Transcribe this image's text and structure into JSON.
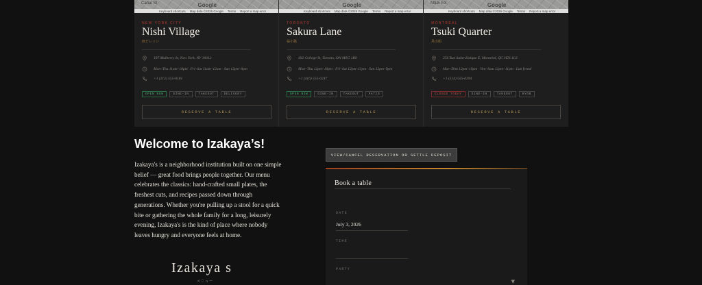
{
  "locations": [
    {
      "map": {
        "street": "Canal St",
        "google": "Google",
        "attribution": [
          "Keyboard shortcuts",
          "Map data ©2026 Google",
          "Terms",
          "Report a map error"
        ]
      },
      "city": "NEW YORK CITY",
      "name": "Nishi Village",
      "jp": "西ビレッジ",
      "address": "187 Mulberry St, New York, NY 10012",
      "hours": "Mon–Thu 11am–10pm · Fri–Sat 11am–12am · Sun 12pm–9pm",
      "phone": "+1 (212) 555-0181",
      "status": "OPEN NOW",
      "status_kind": "open",
      "tags": [
        "DINE-IN",
        "TAKEOUT",
        "DELIVERY"
      ],
      "reserve_label": "RESERVE A TABLE"
    },
    {
      "map": {
        "street": "",
        "google": "Google",
        "attribution": [
          "Keyboard shortcuts",
          "Map data ©2026 Google",
          "Terms",
          "Report a map error"
        ]
      },
      "city": "TORONTO",
      "name": "Sakura Lane",
      "jp": "桜小路",
      "address": "492 College St, Toronto, ON M6G 1B9",
      "hours": "Mon–Thu 12pm–10pm · Fri–Sat 12pm–11pm · Sun 12pm–9pm",
      "phone": "+1 (416) 555-0247",
      "status": "OPEN NOW",
      "status_kind": "open",
      "tags": [
        "DINE-IN",
        "TAKEOUT",
        "PATIO"
      ],
      "reserve_label": "RESERVE A TABLE"
    },
    {
      "map": {
        "street": "MILE EX",
        "google": "Google",
        "attribution": [
          "Keyboard shortcuts",
          "Map data ©2026 Google",
          "Terms",
          "Report a map error"
        ]
      },
      "city": "MONTRÉAL",
      "name": "Tsuki Quarter",
      "jp": "月の街",
      "address": "256 Rue Saint-Zotique E, Montréal, QC H2S 1L6",
      "hours": "Mar–Dim 12pm–10pm · Ven–Sam 12pm–11pm · Lun fermé",
      "phone": "+1 (514) 555-0394",
      "status": "CLOSED TODAY",
      "status_kind": "closed",
      "tags": [
        "DINE-IN",
        "TAKEOUT",
        "BYOB"
      ],
      "reserve_label": "RESERVE A TABLE"
    }
  ],
  "welcome": {
    "title": "Welcome to Izakaya’s!",
    "body": "Izakaya's is a neighborhood institution built on one simple belief — great food brings people together. Our menu celebrates the classics: hand-crafted small plates, the freshest cuts, and recipes passed down through generations. Whether you're pulling up a stool for a quick bite or gathering the whole family for a long, leisurely evening, Izakaya's is the kind of place where nobody leaves hungry and everyone feels at home.",
    "logo": "Izakaya s",
    "logo_sub": "メニュー"
  },
  "booking": {
    "view_cancel_label": "VIEW/CANCEL RESERVATION OR SETTLE DEPOSIT",
    "title": "Book a table",
    "date_label": "DATE",
    "date_value": "July 3, 2026",
    "time_label": "TIME",
    "time_value": "",
    "party_label": "PARTY",
    "party_value": ""
  },
  "colors": {
    "accent_red": "#c0392b",
    "accent_gold": "#b89a5c",
    "open_green": "#4cb07a",
    "closed_red": "#d0504a"
  },
  "icons": {
    "address": "map-pin-icon",
    "hours": "clock-icon",
    "phone": "phone-icon",
    "party": "chevron-down-icon"
  }
}
